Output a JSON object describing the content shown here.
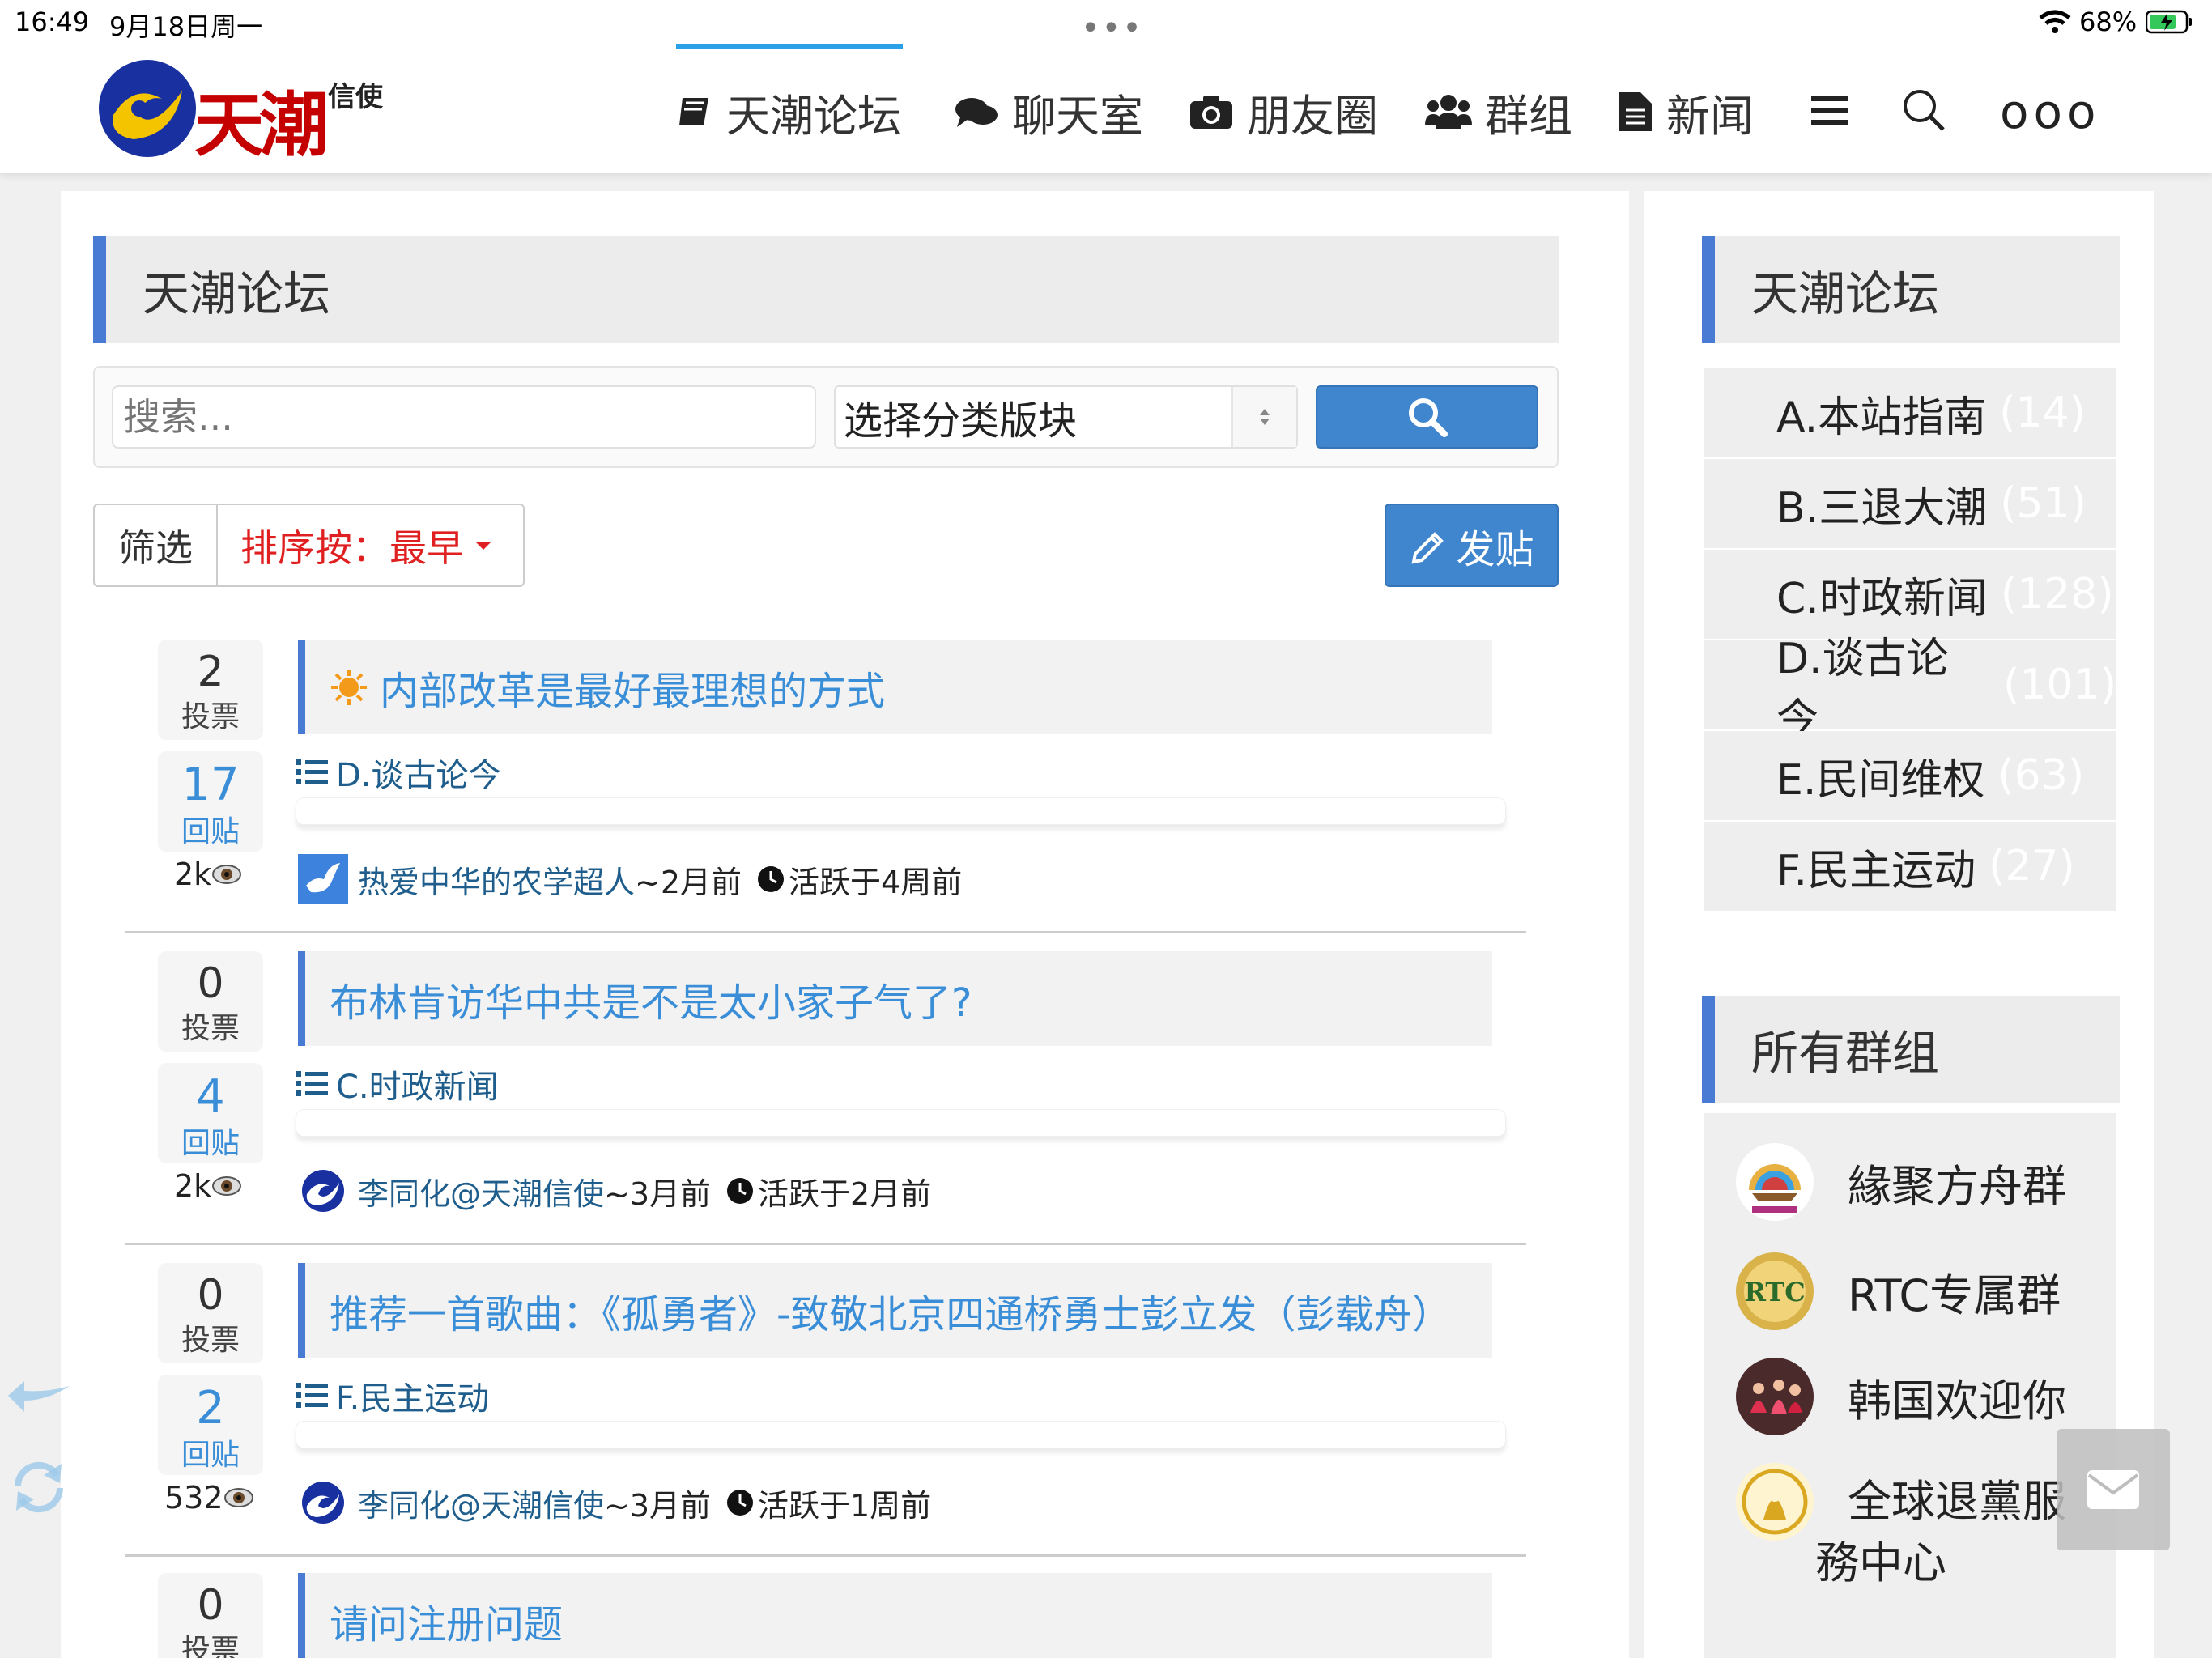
{
  "status": {
    "time": "16:49",
    "date": "9月18日周一",
    "battery": "68%"
  },
  "brand": {
    "logo_text": "天潮",
    "logo_sub": "信使"
  },
  "nav": {
    "forum": "天潮论坛",
    "chat": "聊天室",
    "moments": "朋友圈",
    "groups": "群组",
    "news": "新闻",
    "more": "ooo"
  },
  "main": {
    "title": "天潮论坛",
    "search_placeholder": "搜索...",
    "category_select": "选择分类版块",
    "filter_label": "筛选",
    "sort_label": "排序按：最早",
    "post_button": "发贴"
  },
  "posts": [
    {
      "votes": "2",
      "votes_label": "投票",
      "replies": "17",
      "replies_label": "回贴",
      "views": "2k",
      "title": "内部改革是最好最理想的方式",
      "category": "D.谈古论今",
      "author": "热爱中华的农学超人",
      "posted": "~2月前",
      "active": "活跃于4周前"
    },
    {
      "votes": "0",
      "votes_label": "投票",
      "replies": "4",
      "replies_label": "回贴",
      "views": "2k",
      "title": "布林肯访华中共是不是太小家子气了?",
      "category": "C.时政新闻",
      "author": "李同化@天潮信使",
      "posted": "~3月前",
      "active": "活跃于2月前"
    },
    {
      "votes": "0",
      "votes_label": "投票",
      "replies": "2",
      "replies_label": "回贴",
      "views": "532",
      "title": "推荐一首歌曲：《孤勇者》-致敬北京四通桥勇士彭立发（彭载舟）",
      "category": "F.民主运动",
      "author": "李同化@天潮信使",
      "posted": "~3月前",
      "active": "活跃于1周前"
    },
    {
      "votes": "0",
      "votes_label": "投票",
      "title": "请问注册问题"
    }
  ],
  "sidebar": {
    "forum_title": "天潮论坛",
    "categories": [
      {
        "name": "A.本站指南",
        "count": "(14)"
      },
      {
        "name": "B.三退大潮",
        "count": "(51)"
      },
      {
        "name": "C.时政新闻",
        "count": "(128)"
      },
      {
        "name": "D.谈古论今",
        "count": "(101)"
      },
      {
        "name": "E.民间维权",
        "count": "(63)"
      },
      {
        "name": "F.民主运动",
        "count": "(27)"
      }
    ],
    "groups_title": "所有群组",
    "groups": [
      {
        "name": "緣聚方舟群"
      },
      {
        "name": "RTC专属群"
      },
      {
        "name": "韩国欢迎你"
      },
      {
        "name": "全球退黨服",
        "name_line2": "務中心"
      }
    ]
  },
  "colors": {
    "accent": "#4a7bd4",
    "link": "#3a8ed8",
    "sort": "#e02020",
    "button": "#3f86cf"
  }
}
